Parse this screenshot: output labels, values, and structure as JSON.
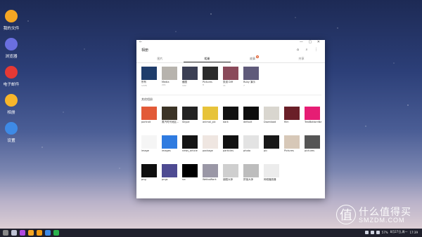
{
  "desktop": {
    "icons": [
      {
        "label": "我的文件",
        "color": "#f5a623",
        "icon": "folder-icon"
      },
      {
        "label": "浏览器",
        "color": "#6a6fe0",
        "icon": "browser-icon"
      },
      {
        "label": "电子邮件",
        "color": "#e53935",
        "icon": "mail-icon"
      },
      {
        "label": "相册",
        "color": "#f8b62b",
        "icon": "gallery-icon"
      },
      {
        "label": "设置",
        "color": "#3e8ae6",
        "icon": "settings-icon"
      }
    ]
  },
  "window": {
    "back_glyph": "←",
    "controls": "— ▢ ✕",
    "app_title": "相册",
    "actions": "⌂ ⌕ ⋮",
    "tabs": [
      {
        "label": "图片",
        "active": false
      },
      {
        "label": "相册",
        "active": true
      },
      {
        "label": "故事",
        "active": false,
        "badge": "N"
      },
      {
        "label": "共享",
        "active": false
      }
    ],
    "albums": [
      {
        "name": "所有",
        "count": "1226",
        "color": "#1f3d6b"
      },
      {
        "name": "Media",
        "count": "201",
        "color": "#b7b3ad"
      },
      {
        "name": "截图",
        "count": "192",
        "color": "#3b3f54"
      },
      {
        "name": "Pictures",
        "count": "8",
        "color": "#2b2b2b"
      },
      {
        "name": "张淑 Diff",
        "count": "11",
        "color": "#8a4a5a"
      },
      {
        "name": "Ruby 演示",
        "count": "7",
        "color": "#5f5a7a"
      }
    ],
    "section_label": "其他相册",
    "folders": [
      {
        "name": "portrait",
        "color": "#e25a38"
      },
      {
        "name": "蒸汽时代地区...",
        "color": "#3b3326"
      },
      {
        "name": "Skype",
        "color": "#222"
      },
      {
        "name": "animal_pic",
        "color": "#e7c33a"
      },
      {
        "name": "dark",
        "color": "#111"
      },
      {
        "name": "default",
        "color": "#0d0d0d"
      },
      {
        "name": "Download",
        "color": "#d9d6cf"
      },
      {
        "name": "film",
        "color": "#6a1f28"
      },
      {
        "name": "TestBottomNav",
        "color": "#e61d74"
      },
      {
        "name": "image",
        "color": "#f5f5f5"
      },
      {
        "name": "images",
        "color": "#2f7be0"
      },
      {
        "name": "news_article",
        "color": "#141414"
      },
      {
        "name": "package",
        "color": "#efe6e1"
      },
      {
        "name": "particles",
        "color": "#111"
      },
      {
        "name": "photo",
        "color": "#e3e3e3"
      },
      {
        "name": "pic",
        "color": "#181818"
      },
      {
        "name": "Pictures",
        "color": "#d7c8b8"
      },
      {
        "name": "pictures",
        "color": "#555"
      },
      {
        "name": "png",
        "color": "#0f0f0f"
      },
      {
        "name": "pngs",
        "color": "#4e4b92"
      },
      {
        "name": "src",
        "color": "#000"
      },
      {
        "name": "WeiboWork",
        "color": "#9a97a6"
      },
      {
        "name": "朋圈大师",
        "color": "#cfcfcf"
      },
      {
        "name": "拼接大师",
        "color": "#bdbdbd"
      },
      {
        "name": "网络播放器",
        "color": "#ececec"
      }
    ]
  },
  "taskbar": {
    "apps": [
      "#888",
      "#c0c4d6",
      "#b04ae0",
      "#f5a623",
      "#f39c12",
      "#3e8ae6",
      "#2bb24c"
    ],
    "time": "17:39",
    "date": "8月27日,周一",
    "status": "57%"
  },
  "watermark": {
    "logo_glyph": "值",
    "cn": "什么值得买",
    "en": "SMZDM.COM"
  }
}
